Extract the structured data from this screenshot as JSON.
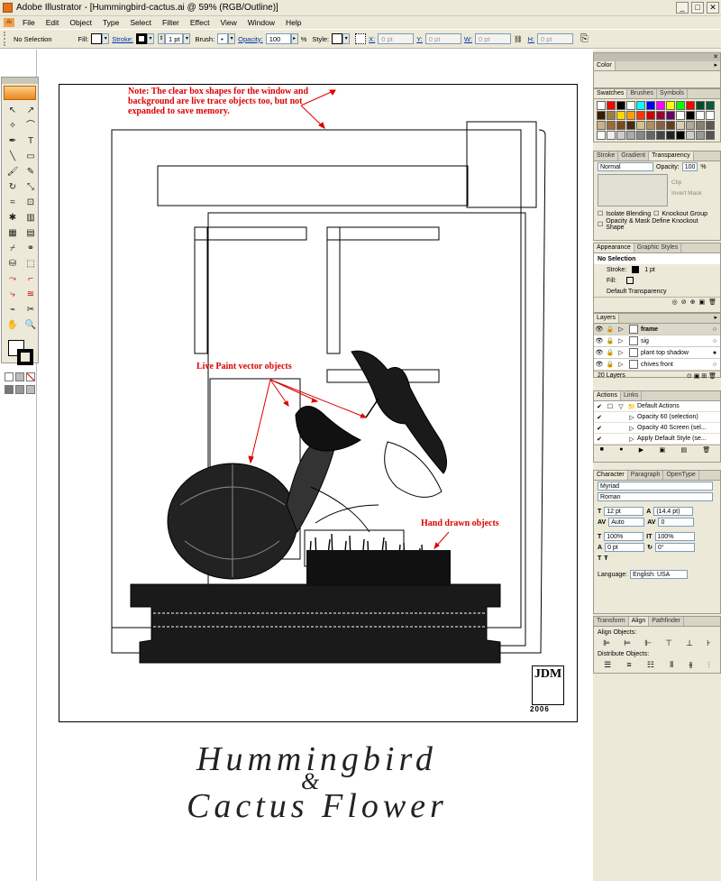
{
  "window": {
    "title": "Adobe Illustrator - [Hummingbird-cactus.ai @ 59% (RGB/Outline)]",
    "min": "_",
    "max": "□",
    "close": "✕"
  },
  "menu": [
    "File",
    "Edit",
    "Object",
    "Type",
    "Select",
    "Filter",
    "Effect",
    "View",
    "Window",
    "Help"
  ],
  "control": {
    "selection": "No Selection",
    "fill_label": "Fill:",
    "stroke_label": "Stroke:",
    "stroke_weight": "1 pt",
    "brush_label": "Brush:",
    "opacity_label": "Opacity:",
    "opacity_value": "100",
    "opacity_unit": "%",
    "style_label": "Style:",
    "x_label": "X:",
    "x_value": "0 pt",
    "y_label": "Y:",
    "y_value": "0 pt",
    "w_label": "W:",
    "w_value": "0 pt",
    "h_label": "H:",
    "h_value": "0 pt"
  },
  "canvas": {
    "note": "Note: The clear box shapes  for the window and background are live trace objects too, but not expanded to save memory.",
    "live_paint": "Live Paint vector objects",
    "hand_drawn": "Hand drawn objects",
    "title_line1": "Hummingbird",
    "title_amp": "&",
    "title_line2": "Cactus Flower",
    "signature": "JDM",
    "signature_year": "2006"
  },
  "panels": {
    "color": {
      "tab": "Color"
    },
    "swatches": {
      "tabs": [
        "Swatches",
        "Brushes",
        "Symbols"
      ]
    },
    "transparency": {
      "tabs": [
        "Stroke",
        "Gradient",
        "Transparency"
      ],
      "blend": "Normal",
      "opacity_label": "Opacity:",
      "opacity": "100",
      "unit": "%",
      "clip": "Clip",
      "invert": "Invert Mask",
      "isolate": "Isolate Blending",
      "knockout": "Knockout Group",
      "define": "Opacity & Mask Define Knockout Shape"
    },
    "appearance": {
      "tabs": [
        "Appearance",
        "Graphic Styles"
      ],
      "title": "No Selection",
      "stroke_label": "Stroke:",
      "stroke_value": "1 pt",
      "fill_label": "Fill:",
      "default": "Default Transparency"
    },
    "layers": {
      "tab": "Layers",
      "rows": [
        "frame",
        "sig",
        "plant top shadow",
        "chives front"
      ],
      "count": "20 Layers"
    },
    "actions": {
      "tabs": [
        "Actions",
        "Links"
      ],
      "rows": [
        "Default Actions",
        "Opacity 60 (selection)",
        "Opacity 40 Screen (sel...",
        "Apply Default Style (se..."
      ]
    },
    "character": {
      "tabs": [
        "Character",
        "Paragraph",
        "OpenType"
      ],
      "font": "Myriad",
      "style": "Roman",
      "size": "12 pt",
      "leading": "(14.4 pt)",
      "kerning": "Auto",
      "tracking": "0",
      "vscale": "100%",
      "hscale": "100%",
      "baseline": "0 pt",
      "rotation": "0°",
      "language_label": "Language:",
      "language": "English: USA"
    },
    "align": {
      "tabs": [
        "Transform",
        "Align",
        "Pathfinder"
      ],
      "align_label": "Align Objects:",
      "distribute_label": "Distribute Objects:"
    }
  },
  "swatch_colors": [
    "#ffffff",
    "#ff0000",
    "#000000",
    "#ffffff",
    "#00ffff",
    "#0000ff",
    "#ff00ff",
    "#ffff00",
    "#00ff00",
    "#ff0000",
    "#004a2a",
    "#0a5a3a",
    "#3c1a00",
    "#9a8040",
    "#ffd700",
    "#ff9c00",
    "#ff3300",
    "#cc0000",
    "#990033",
    "#660066",
    "#ffffff",
    "#000000",
    "#fff",
    "#fff",
    "#c8b08a",
    "#a06a3a",
    "#7a4a20",
    "#4a2a10",
    "#d4c088",
    "#b09060",
    "#886040",
    "#604020",
    "#d8d0b0",
    "#b0a890",
    "#888070",
    "#605850",
    "#ffffff",
    "#eeeeee",
    "#cccccc",
    "#aaaaaa",
    "#888888",
    "#666666",
    "#444444",
    "#222222",
    "#000000",
    "#ccc",
    "#999",
    "#555"
  ]
}
